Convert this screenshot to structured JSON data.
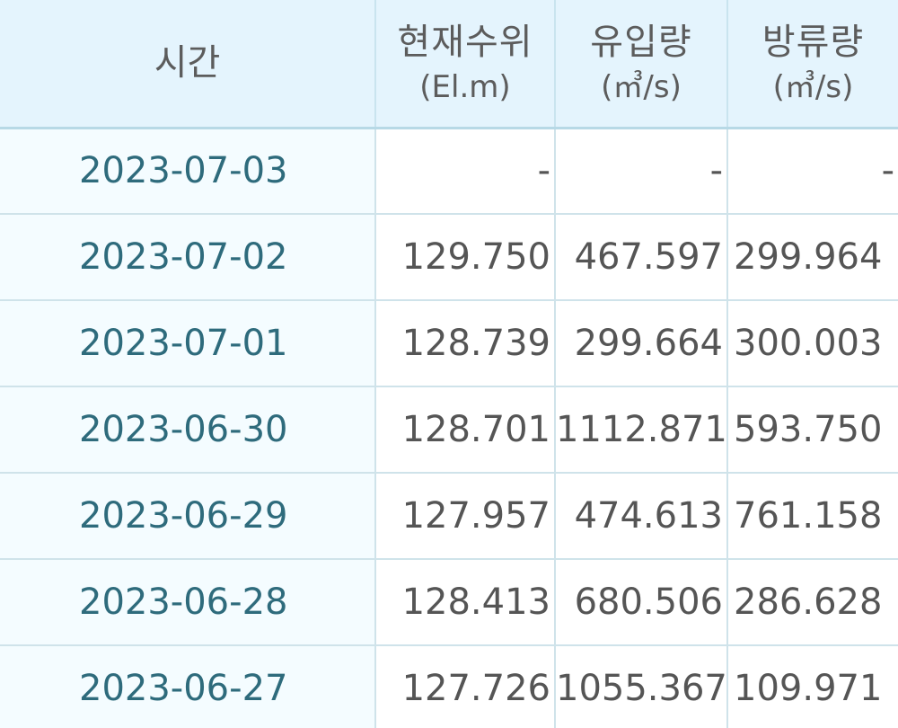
{
  "header": {
    "time": "시간",
    "level": {
      "label": "현재수위",
      "unit": "(El.m)"
    },
    "inflow": {
      "label": "유입량",
      "unit": "(㎥/s)"
    },
    "outflow": {
      "label": "방류량",
      "unit": "(㎥/s)"
    }
  },
  "rows": [
    {
      "time": "2023-07-03",
      "level": "-",
      "inflow": "-",
      "outflow": "-"
    },
    {
      "time": "2023-07-02",
      "level": "129.750",
      "inflow": "467.597",
      "outflow": "299.964"
    },
    {
      "time": "2023-07-01",
      "level": "128.739",
      "inflow": "299.664",
      "outflow": "300.003"
    },
    {
      "time": "2023-06-30",
      "level": "128.701",
      "inflow": "1112.871",
      "outflow": "593.750"
    },
    {
      "time": "2023-06-29",
      "level": "127.957",
      "inflow": "474.613",
      "outflow": "761.158"
    },
    {
      "time": "2023-06-28",
      "level": "128.413",
      "inflow": "680.506",
      "outflow": "286.628"
    },
    {
      "time": "2023-06-27",
      "level": "127.726",
      "inflow": "1055.367",
      "outflow": "109.971"
    }
  ]
}
